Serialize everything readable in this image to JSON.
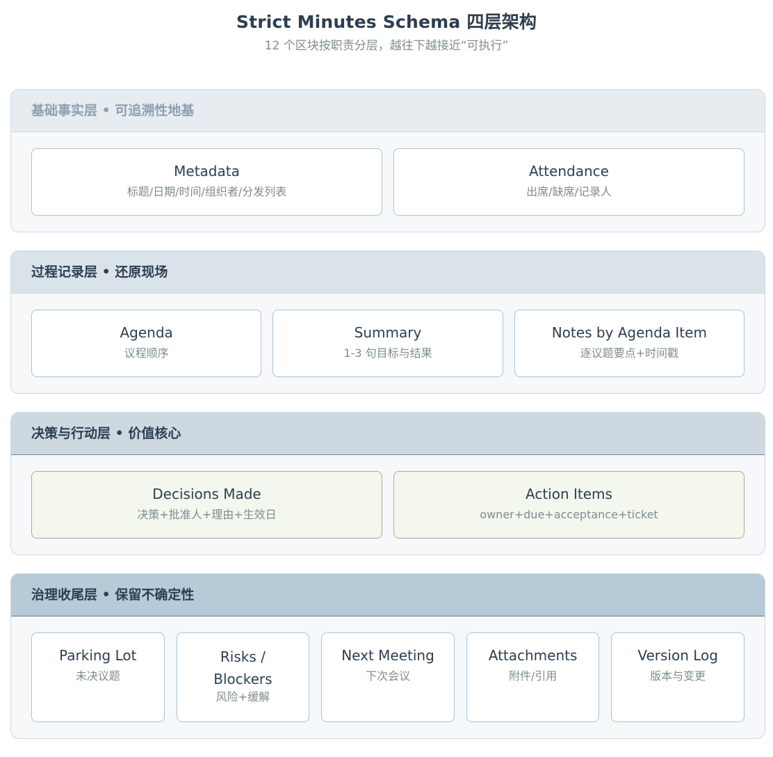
{
  "header": {
    "title": "Strict Minutes Schema 四层架构",
    "subtitle": "12 个区块按职责分层，越往下越接近“可执行”"
  },
  "layers": [
    {
      "title": "基础事实层 • 可追溯性地基",
      "cards": [
        {
          "title": "Metadata",
          "desc": "标题/日期/时间/组织者/分发列表"
        },
        {
          "title": "Attendance",
          "desc": "出席/缺席/记录人"
        }
      ]
    },
    {
      "title": "过程记录层 • 还原现场",
      "cards": [
        {
          "title": "Agenda",
          "desc": "议程顺序"
        },
        {
          "title": "Summary",
          "desc": "1-3 句目标与结果"
        },
        {
          "title": "Notes by Agenda Item",
          "desc": "逐议题要点+时间戳"
        }
      ]
    },
    {
      "title": "决策与行动层 • 价值核心",
      "cards": [
        {
          "title": "Decisions Made",
          "desc": "决策+批准人+理由+生效日"
        },
        {
          "title": "Action Items",
          "desc": "owner+due+acceptance+ticket"
        }
      ]
    },
    {
      "title": "治理收尾层 • 保留不确定性",
      "cards": [
        {
          "title": "Parking Lot",
          "desc": "未决议题"
        },
        {
          "title": "Risks / Blockers",
          "desc": "风险+缓解"
        },
        {
          "title": "Next Meeting",
          "desc": "下次会议"
        },
        {
          "title": "Attachments",
          "desc": "附件/引用"
        },
        {
          "title": "Version Log",
          "desc": "版本与变更"
        }
      ]
    }
  ],
  "colors": {
    "title_text": "#2c3e50",
    "muted_text": "#7f8c8d",
    "card_border": "#a7c3d6",
    "core_card_bg": "#f4f7ee"
  }
}
